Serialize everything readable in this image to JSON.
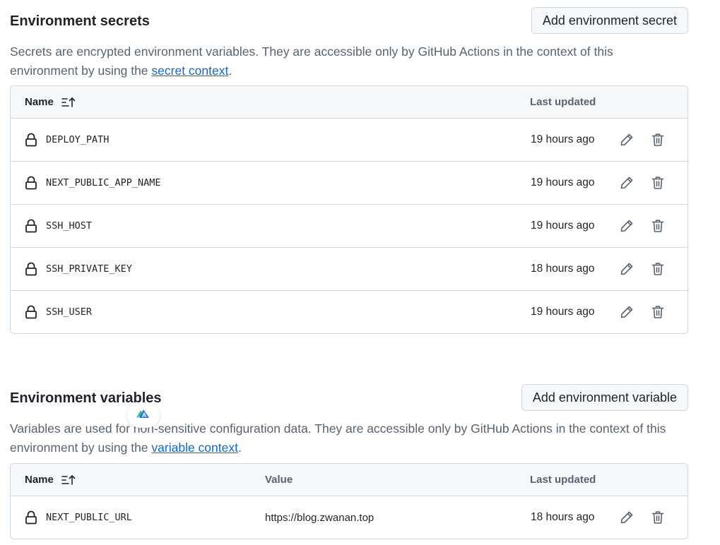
{
  "secrets": {
    "title": "Environment secrets",
    "add_button": "Add environment secret",
    "desc_text": "Secrets are encrypted environment variables. They are accessible only by GitHub Actions in the context of this environment by using the ",
    "desc_link": "secret context",
    "desc_end": ".",
    "headers": {
      "name": "Name",
      "updated": "Last updated"
    },
    "rows": [
      {
        "name": "DEPLOY_PATH",
        "updated": "19 hours ago"
      },
      {
        "name": "NEXT_PUBLIC_APP_NAME",
        "updated": "19 hours ago"
      },
      {
        "name": "SSH_HOST",
        "updated": "19 hours ago"
      },
      {
        "name": "SSH_PRIVATE_KEY",
        "updated": "18 hours ago"
      },
      {
        "name": "SSH_USER",
        "updated": "19 hours ago"
      }
    ]
  },
  "variables": {
    "title": "Environment variables",
    "add_button": "Add environment variable",
    "desc_text": "Variables are used for non-sensitive configuration data. They are accessible only by GitHub Actions in the context of this environment by using the ",
    "desc_link": "variable context",
    "desc_end": ".",
    "headers": {
      "name": "Name",
      "value": "Value",
      "updated": "Last updated"
    },
    "rows": [
      {
        "name": "NEXT_PUBLIC_URL",
        "value": "https://blog.zwanan.top",
        "updated": "18 hours ago"
      }
    ]
  },
  "icons": [
    "lock-icon",
    "pencil-icon",
    "trash-icon",
    "sort-ascending-icon",
    "translate-extension-icon"
  ],
  "colors": {
    "link": "#0969da",
    "muted": "#59636e",
    "border": "#d1d9e0",
    "header_bg": "#f6f8fa"
  }
}
